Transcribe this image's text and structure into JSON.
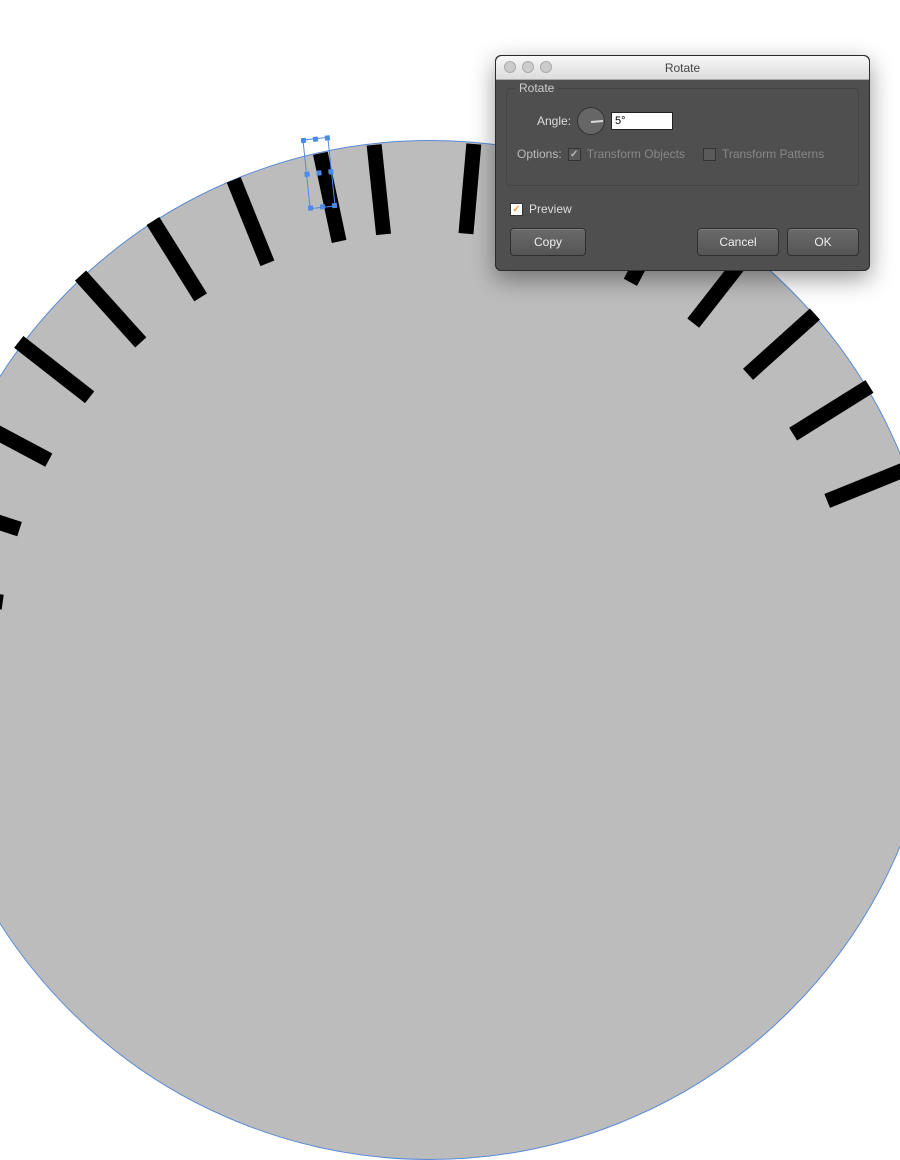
{
  "dialog": {
    "title": "Rotate",
    "fieldset_label": "Rotate",
    "angle_label": "Angle:",
    "angle_value": "5°",
    "options_label": "Options:",
    "transform_objects_label": "Transform Objects",
    "transform_patterns_label": "Transform Patterns",
    "preview_label": "Preview",
    "copy_label": "Copy",
    "cancel_label": "Cancel",
    "ok_label": "OK",
    "transform_objects_checked": true,
    "transform_patterns_checked": false,
    "preview_checked": true
  },
  "canvas": {
    "shape": "circle",
    "fill_color": "#bcbcbc",
    "stroke_color": "#5a8bd6",
    "tick_count_visible": 15,
    "selected_tick_index": 3
  }
}
